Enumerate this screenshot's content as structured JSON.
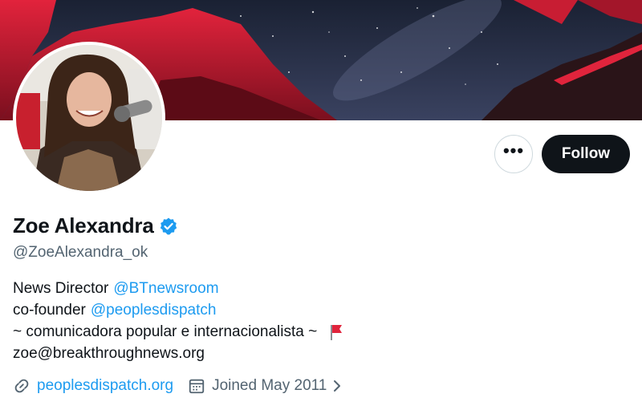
{
  "profile": {
    "display_name": "Zoe Alexandra",
    "handle": "@ZoeAlexandra_ok",
    "verified": true
  },
  "actions": {
    "more_label": "•••",
    "follow_label": "Follow"
  },
  "bio": {
    "line1_text": "News Director",
    "line1_mention": "@BTnewsroom",
    "line2_text": "co-founder",
    "line2_mention": "@peoplesdispatch",
    "line3_text": "~ comunicadora popular e internacionalista ~",
    "line4_text": "zoe@breakthroughnews.org"
  },
  "meta": {
    "website": "peoplesdispatch.org",
    "joined": "Joined May 2011"
  },
  "icons": {
    "link": "link-icon",
    "calendar": "calendar-icon",
    "verified": "verified-badge-icon",
    "flag": "red-flag-icon",
    "chevron": "chevron-right-icon"
  },
  "colors": {
    "accent": "#1d9bf0",
    "text": "#0f1419",
    "secondary": "#536471",
    "follow_bg": "#0f1419"
  }
}
